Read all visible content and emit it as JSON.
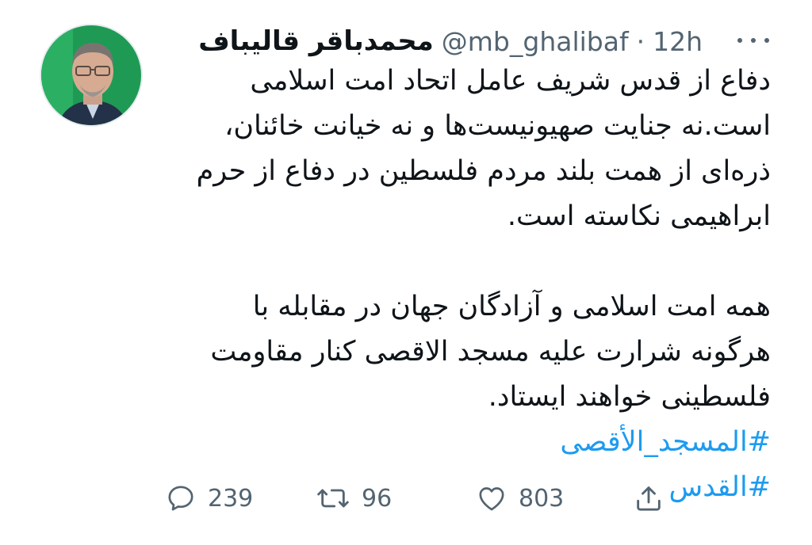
{
  "tweet": {
    "author": {
      "name": "محمدباقر قالیباف",
      "handle": "@mb_ghalibaf",
      "separator": "·",
      "time": "12h"
    },
    "lines": [
      "دفاع از قدس شریف عامل اتحاد امت اسلامی",
      "است.نه جنایت صهیونیست‌ها و نه خیانت خائنان،",
      "ذره‌ای از همت بلند مردم فلسطین در دفاع از حرم",
      "ابراهیمی نکاسته است.",
      "همه امت اسلامی و آزادگان جهان در مقابله با",
      "هرگونه شرارت علیه مسجد الاقصی کنار مقاومت",
      "فلسطینی خواهند ایستاد."
    ],
    "hashtags": [
      "#المسجد_الأقصى",
      "#القدس"
    ],
    "actions": {
      "replies": "239",
      "retweets": "96",
      "likes": "803"
    }
  },
  "icons": {
    "reply": "speech-bubble-icon",
    "retweet": "retweet-arrows-icon",
    "like": "heart-icon",
    "share": "share-upload-icon",
    "more": "more-dots-icon"
  },
  "colors": {
    "text": "#0f1419",
    "secondary": "#536471",
    "link": "#1d9bf0",
    "background": "#ffffff"
  }
}
